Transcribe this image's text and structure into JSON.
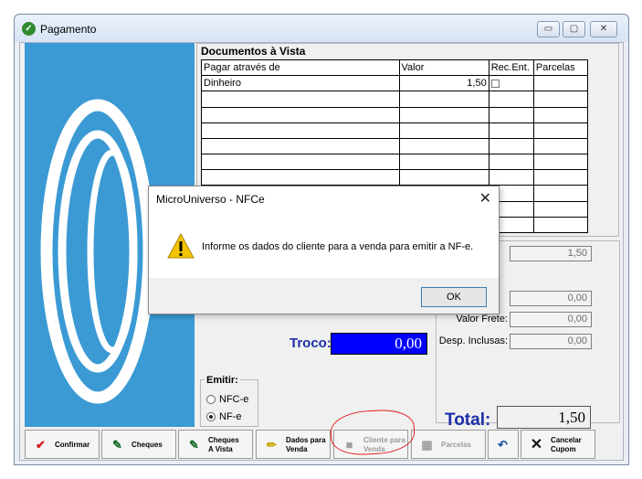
{
  "window": {
    "title": "Pagamento",
    "min_glyph": "▭",
    "max_glyph": "▢",
    "close_glyph": "✕"
  },
  "docs": {
    "title": "Documentos à Vista",
    "columns": [
      "Pagar através de",
      "Valor",
      "Rec.Ent.",
      "Parcelas"
    ],
    "rows": [
      {
        "pagar": "Dinheiro",
        "valor": "1,50",
        "rec_ent": false,
        "parcelas": ""
      }
    ]
  },
  "totals": {
    "field1_value": "1,50",
    "field2_value": "0,00",
    "valor_frete_label": "Valor Frete:",
    "valor_frete_value": "0,00",
    "desp_inclusas_label": "Desp. Inclusas:",
    "desp_inclusas_value": "0,00",
    "total_label": "Total:",
    "total_value": "1,50"
  },
  "troco": {
    "label": "Troco:",
    "value": "0,00"
  },
  "emitir": {
    "title": "Emitir:",
    "options": [
      "NFC-e",
      "NF-e"
    ],
    "selected": "NF-e"
  },
  "toolbar": {
    "confirmar": "Confirmar",
    "cheques": "Cheques",
    "cheques_a_vista": "Cheques\nA Vista",
    "dados_para_venda": "Dados para\nVenda",
    "cliente_para_venda": "Cliente para\nVenda",
    "parcelas": "Parcelas",
    "cancelar_cupom": "Cancelar\nCupom"
  },
  "dialog": {
    "title": "MicroUniverso - NFCe",
    "message": "Informe os dados do cliente para a venda para emitir a NF-e.",
    "ok_label": "OK",
    "close_glyph": "✕"
  },
  "colors": {
    "logo_bg": "#3b9ad4",
    "troco_bg": "#0000ff",
    "accent_blue": "#1c2fa8",
    "annotation_red": "#e02020"
  }
}
